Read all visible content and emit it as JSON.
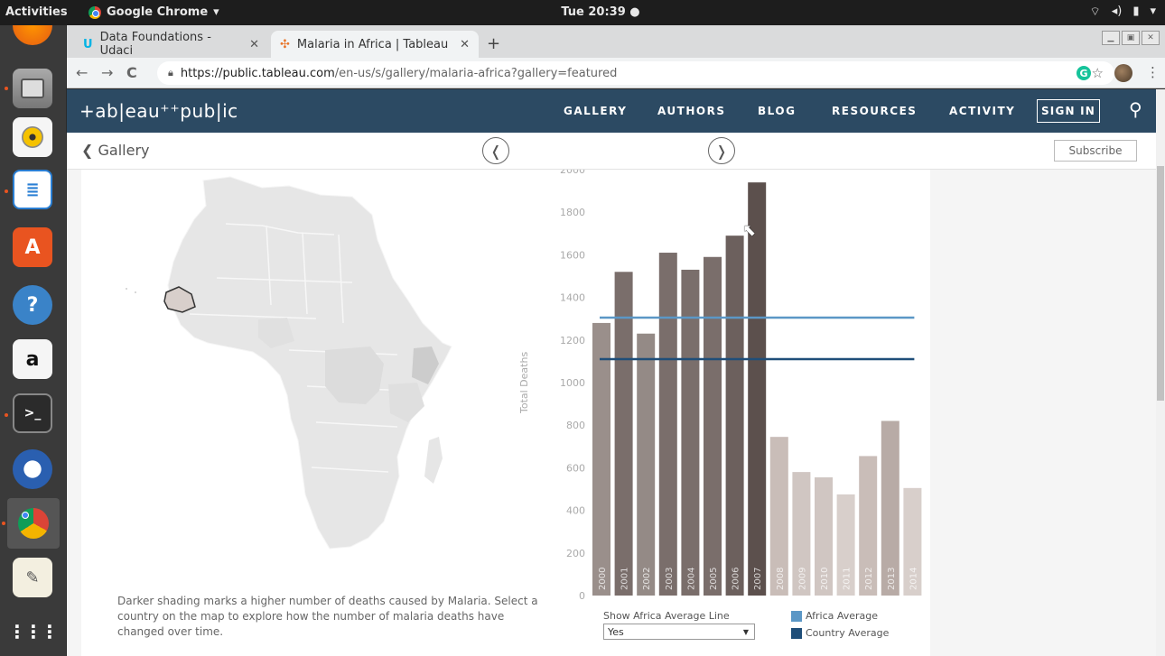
{
  "topbar": {
    "activities": "Activities",
    "app_name": "Google Chrome",
    "clock": "Tue 20:39 ●"
  },
  "browser": {
    "tabs": [
      {
        "title": "Data Foundations - Udaci",
        "active": false
      },
      {
        "title": "Malaria in Africa | Tableau",
        "active": true
      }
    ],
    "url_host": "https://public.tableau.com",
    "url_path": "/en-us/s/gallery/malaria-africa?gallery=featured"
  },
  "tableau": {
    "logo": "+ab|eau⁺⁺pub|ic",
    "nav": [
      "GALLERY",
      "AUTHORS",
      "BLOG",
      "RESOURCES",
      "ACTIVITY"
    ],
    "sign_in": "SIGN IN",
    "back_label": "Gallery",
    "subscribe": "Subscribe"
  },
  "viz": {
    "caption": "Darker shading marks a higher number of deaths caused by Malaria. Select a country on the map to explore how the number of malaria deaths have changed over time.",
    "avg_control_label": "Show Africa Average Line",
    "avg_control_value": "Yes",
    "legend": [
      {
        "label": "Africa Average",
        "color": "#5b97c6"
      },
      {
        "label": "Country Average",
        "color": "#1f4e79"
      }
    ]
  },
  "chart_data": {
    "type": "bar",
    "ylabel": "Total Deaths",
    "ylim": [
      0,
      2000
    ],
    "yticks": [
      0,
      200,
      400,
      600,
      800,
      1000,
      1200,
      1400,
      1600,
      1800,
      2000
    ],
    "categories": [
      "2000",
      "2001",
      "2002",
      "2003",
      "2004",
      "2005",
      "2006",
      "2007",
      "2008",
      "2009",
      "2010",
      "2011",
      "2012",
      "2013",
      "2014"
    ],
    "values": [
      1280,
      1520,
      1230,
      1610,
      1530,
      1590,
      1690,
      1940,
      745,
      580,
      555,
      475,
      655,
      820,
      505
    ],
    "bar_colors": [
      "#9a8f8b",
      "#7a6e6b",
      "#948a86",
      "#7a6e6b",
      "#7a6e6b",
      "#7a6e6b",
      "#6c605d",
      "#5c504d",
      "#c9bdb8",
      "#d0c6c2",
      "#d0c6c2",
      "#d8cfcb",
      "#c9bdb8",
      "#b8aba6",
      "#d8cfcb"
    ],
    "reference_lines": [
      {
        "name": "Africa Average",
        "value": 1305,
        "color": "#5b97c6"
      },
      {
        "name": "Country Average",
        "value": 1110,
        "color": "#1f4e79"
      }
    ]
  }
}
